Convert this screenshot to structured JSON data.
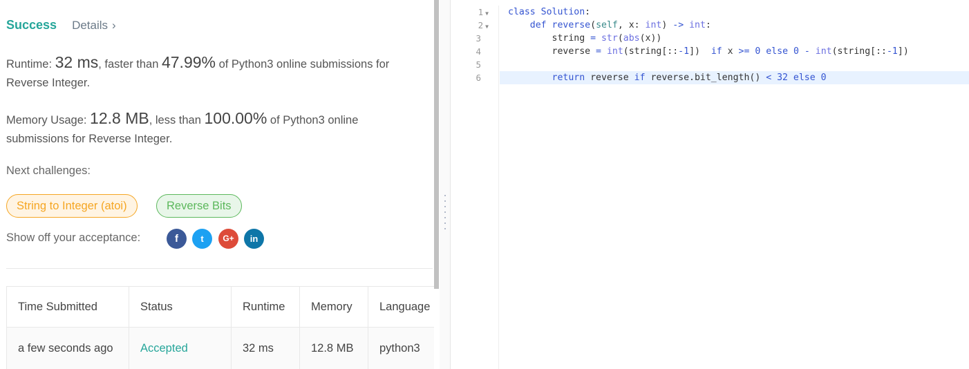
{
  "result": {
    "status": "Success",
    "details_label": "Details",
    "details_chevron": "›"
  },
  "runtime": {
    "label": "Runtime: ",
    "value": "32 ms",
    "mid": ", faster than ",
    "percent": "47.99%",
    "tail": " of Python3 online submissions for Reverse Integer."
  },
  "memory": {
    "label": "Memory Usage: ",
    "value": "12.8 MB",
    "mid": ", less than ",
    "percent": "100.00%",
    "tail": " of Python3 online submissions for Reverse Integer."
  },
  "next_challenges": {
    "label": "Next challenges:",
    "items": [
      {
        "label": "String to Integer (atoi)",
        "color": "#f5a623"
      },
      {
        "label": "Reverse Bits",
        "color": "#5cb85c"
      }
    ]
  },
  "share": {
    "label": "Show off your acceptance:",
    "icons": [
      {
        "name": "facebook-icon",
        "glyph": "f",
        "color": "#3b5998"
      },
      {
        "name": "twitter-icon",
        "glyph": "t",
        "color": "#1da1f2"
      },
      {
        "name": "google-plus-icon",
        "glyph": "G+",
        "color": "#dd4b39"
      },
      {
        "name": "linkedin-icon",
        "glyph": "in",
        "color": "#0e76a8"
      }
    ]
  },
  "table": {
    "headers": [
      "Time Submitted",
      "Status",
      "Runtime",
      "Memory",
      "Language"
    ],
    "rows": [
      [
        "a few seconds ago",
        "Accepted",
        "32 ms",
        "12.8 MB",
        "python3"
      ]
    ]
  },
  "editor": {
    "line_numbers": [
      "1",
      "2",
      "3",
      "4",
      "5",
      "6"
    ],
    "fold_marker": "▼",
    "lines": [
      [
        [
          "kw",
          "class "
        ],
        [
          "kw",
          "Solution"
        ],
        [
          "",
          "："
        ]
      ],
      [],
      [],
      [],
      [],
      []
    ]
  }
}
